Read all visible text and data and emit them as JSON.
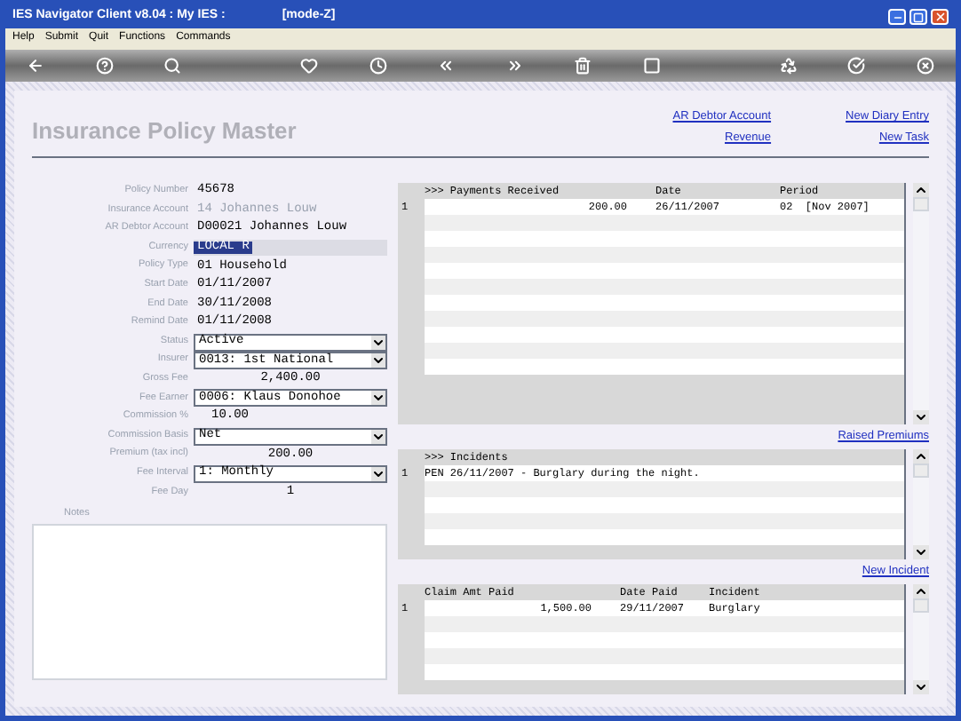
{
  "window": {
    "title": "IES Navigator Client v8.04 : My IES :",
    "mode": "[mode-Z]"
  },
  "menu": [
    "Help",
    "Submit",
    "Quit",
    "Functions",
    "Commands"
  ],
  "page": {
    "title": "Insurance Policy Master",
    "links": [
      "AR Debtor Account",
      "New Diary Entry",
      "Revenue",
      "New Task"
    ]
  },
  "fields": [
    {
      "label": "Policy Number",
      "value": "45678",
      "kind": "text"
    },
    {
      "label": "Insurance Account",
      "value": "14 Johannes Louw",
      "kind": "readonly"
    },
    {
      "label": "AR Debtor Account",
      "value": "D00021 Johannes Louw",
      "kind": "text"
    },
    {
      "label": "Currency",
      "value": "LOCAL R",
      "kind": "selected"
    },
    {
      "label": "Policy Type",
      "value": "01 Household",
      "kind": "text"
    },
    {
      "label": "Start Date",
      "value": "01/11/2007",
      "kind": "text"
    },
    {
      "label": "End Date",
      "value": "30/11/2008",
      "kind": "text"
    },
    {
      "label": "Remind Date",
      "value": "01/11/2008",
      "kind": "text"
    },
    {
      "label": "Status",
      "value": "Active",
      "kind": "select"
    },
    {
      "label": "Insurer",
      "value": "0013: 1st National",
      "kind": "select"
    },
    {
      "label": "Gross Fee",
      "value": "2,400.00",
      "kind": "number"
    },
    {
      "label": "Fee Earner",
      "value": "0006: Klaus Donohoe",
      "kind": "select"
    },
    {
      "label": "Commission %",
      "value": "10.00",
      "kind": "short"
    },
    {
      "label": "Commission Basis",
      "value": "Net",
      "kind": "select"
    },
    {
      "label": "Premium (tax incl)",
      "value": "200.00",
      "kind": "number"
    },
    {
      "label": "Fee Interval",
      "value": "1: Monthly",
      "kind": "select"
    },
    {
      "label": "Fee Day",
      "value": "1",
      "kind": "number"
    }
  ],
  "notes": {
    "label": "Notes"
  },
  "grids": [
    {
      "kind": "payments",
      "columns": [
        ">>> Payments Received",
        "Date",
        "Period"
      ],
      "rows": [
        {
          "number": "1",
          "cells": [
            "200.00",
            "26/11/2007",
            "02  [Nov 2007]"
          ]
        }
      ],
      "link": "Raised Premiums"
    },
    {
      "kind": "incidents",
      "columns": [
        ">>> Incidents"
      ],
      "rows": [
        {
          "number": "1",
          "cells": [
            "PEN 26/11/2007 - Burglary during the night."
          ]
        }
      ],
      "link": "New Incident"
    },
    {
      "kind": "claims",
      "columns": [
        "Claim Amt Paid",
        "Date Paid",
        "Incident"
      ],
      "rows": [
        {
          "number": "1",
          "cells": [
            "1,500.00",
            "29/11/2007",
            "Burglary"
          ]
        }
      ]
    }
  ]
}
